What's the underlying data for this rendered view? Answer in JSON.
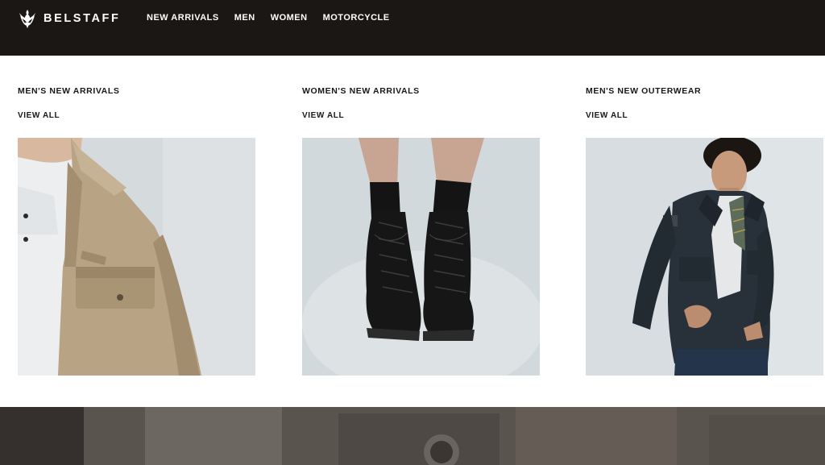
{
  "header": {
    "brand": "BELSTAFF",
    "logo_icon": "phoenix-icon",
    "nav": [
      {
        "label": "NEW ARRIVALS"
      },
      {
        "label": "MEN"
      },
      {
        "label": "WOMEN"
      },
      {
        "label": "MOTORCYCLE"
      }
    ],
    "colors": {
      "bar": "#1b1714",
      "text": "#ffffff"
    }
  },
  "menu": {
    "columns": [
      {
        "title": "MEN'S NEW ARRIVALS",
        "link": "VIEW ALL",
        "image": "men-overshirt-photo"
      },
      {
        "title": "WOMEN'S NEW ARRIVALS",
        "link": "VIEW ALL",
        "image": "women-boots-photo"
      },
      {
        "title": "MEN'S NEW OUTERWEAR",
        "link": "VIEW ALL",
        "image": "men-jacket-photo"
      }
    ]
  }
}
